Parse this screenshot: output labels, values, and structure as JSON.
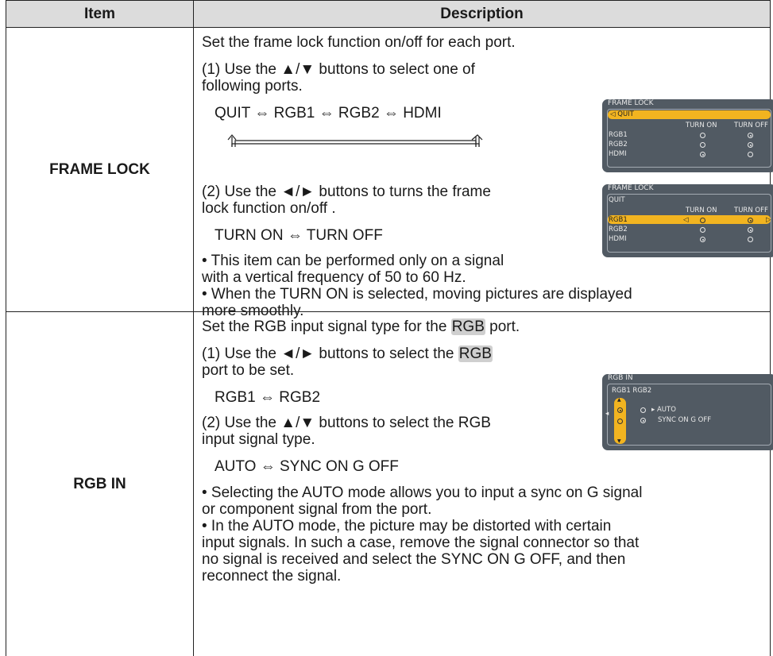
{
  "headers": {
    "item": "Item",
    "description": "Description"
  },
  "rows": {
    "frame_lock": {
      "item": "FRAME LOCK",
      "intro": "Set the frame lock function on/off for each port.",
      "step1_line1": "(1) Use the ▲/▼ buttons to select one of",
      "step1_line2": "following ports.",
      "cycle1": "QUIT ⇔ RGB1 ⇔ RGB2 ⇔ HDMI",
      "step2_line1": "(2) Use the ◄/► buttons to turns the frame",
      "step2_line2": "lock function on/off .",
      "cycle2": "TURN ON ⇔ TURN OFF",
      "note1_line1": "• This item can be performed only on a signal",
      "note1_line2": "with a vertical frequency of 50 to 60 Hz.",
      "note2_line1": "• When the TURN ON is selected, moving pictures are displayed",
      "note2_line2": "more smoothly."
    },
    "rgb_in": {
      "item": "RGB IN",
      "intro_pre": "Set the RGB input signal type for the ",
      "intro_hl": "RGB",
      "intro_post": " port.",
      "step1_pre": "(1) Use the ◄/► buttons to select the ",
      "step1_hl": "RGB",
      "step1_line2": "port to be set.",
      "cycle1": "RGB1 ⇔ RGB2",
      "step2_line1": "(2) Use the ▲/▼ buttons to select the RGB",
      "step2_line2": "input signal type.",
      "cycle2": "AUTO ⇔ SYNC ON G OFF",
      "note1_line1": "• Selecting the AUTO mode allows you to input a sync on G signal",
      "note1_line2": "or component signal from the port.",
      "note2_line1": "• In the AUTO mode, the picture may be distorted with certain",
      "note2_line2": "input signals. In such a case, remove the signal connector so that",
      "note2_line3": "no signal is received and select the SYNC ON G OFF, and then",
      "note2_line4": "reconnect the signal."
    }
  },
  "osd_frame_lock_1": {
    "title": "FRAME LOCK",
    "quit": "QUIT",
    "col_on": "TURN ON",
    "col_off": "TURN OFF",
    "rows": [
      "RGB1",
      "RGB2",
      "HDMI"
    ],
    "highlight": "QUIT"
  },
  "osd_frame_lock_2": {
    "title": "FRAME LOCK",
    "quit": "QUIT",
    "col_on": "TURN ON",
    "col_off": "TURN OFF",
    "rows": [
      "RGB1",
      "RGB2",
      "HDMI"
    ],
    "highlight": "RGB1"
  },
  "osd_rgb_in": {
    "title": "RGB IN",
    "tabs": "RGB1  RGB2",
    "opt_auto": "AUTO",
    "opt_sync": "SYNC ON G OFF"
  },
  "colors": {
    "osd_bg": "#515a63",
    "osd_highlight": "#f2b420",
    "header_bg": "#dcdcdc"
  }
}
